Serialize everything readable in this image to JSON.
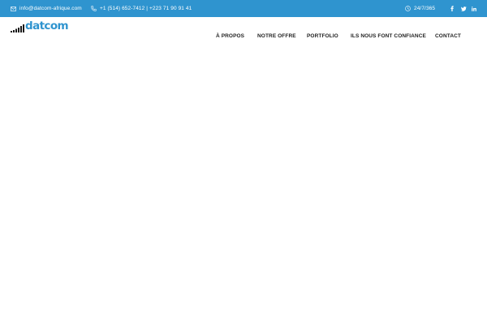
{
  "topbar": {
    "email": "info@datcom-afrique.com",
    "phone": "+1 (514) 652-7412 | +223 71 90 91 41",
    "hours": "24/7/365",
    "social": [
      {
        "icon": "facebook-icon",
        "glyph": "f"
      },
      {
        "icon": "twitter-icon",
        "glyph": "t"
      },
      {
        "icon": "linkedin-icon",
        "glyph": "in"
      }
    ]
  },
  "logo": {
    "text": "datcom"
  },
  "nav": {
    "items": [
      "À PROPOS",
      "NOTRE OFFRE",
      "PORTFOLIO",
      "ILS NOUS FONT CONFIANCE",
      "CONTACT"
    ]
  },
  "colors": {
    "accent": "#2f94cf",
    "text": "#222222",
    "background": "#ffffff"
  }
}
